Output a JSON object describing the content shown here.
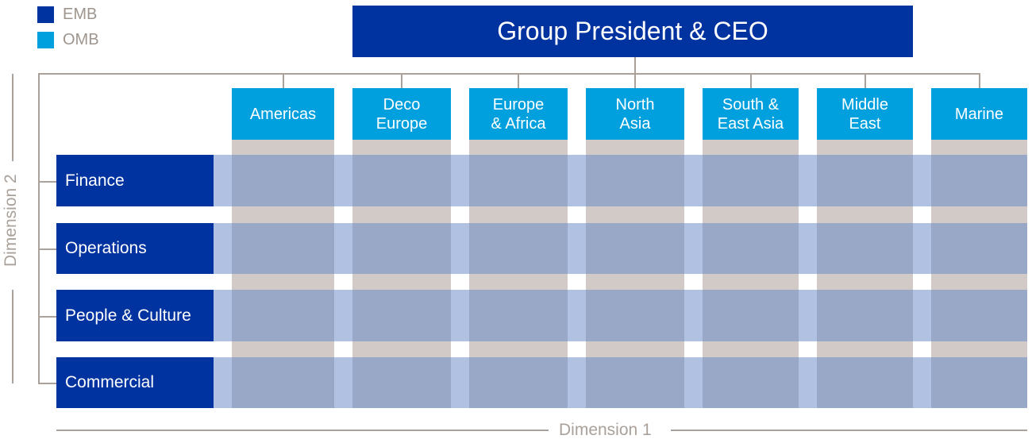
{
  "legend": [
    {
      "label": "EMB",
      "color": "#0033a0"
    },
    {
      "label": "OMB",
      "color": "#00a0df"
    }
  ],
  "ceo": {
    "label": "Group President & CEO"
  },
  "columns": [
    {
      "label": "Americas"
    },
    {
      "label": "Deco\nEurope"
    },
    {
      "label": "Europe\n& Africa"
    },
    {
      "label": "North\nAsia"
    },
    {
      "label": "South &\nEast Asia"
    },
    {
      "label": "Middle\nEast"
    },
    {
      "label": "Marine"
    }
  ],
  "rows": [
    {
      "label": "Finance"
    },
    {
      "label": "Operations"
    },
    {
      "label": "People & Culture"
    },
    {
      "label": "Commercial"
    }
  ],
  "axes": {
    "dimension1": "Dimension 1",
    "dimension2": "Dimension 2"
  },
  "colors": {
    "emb": "#0033a0",
    "omb": "#00a0df",
    "connector": "#a9a19a",
    "beige": "#d1cac6",
    "band": "#b1c1e1",
    "cell": "#9aa8c8"
  }
}
